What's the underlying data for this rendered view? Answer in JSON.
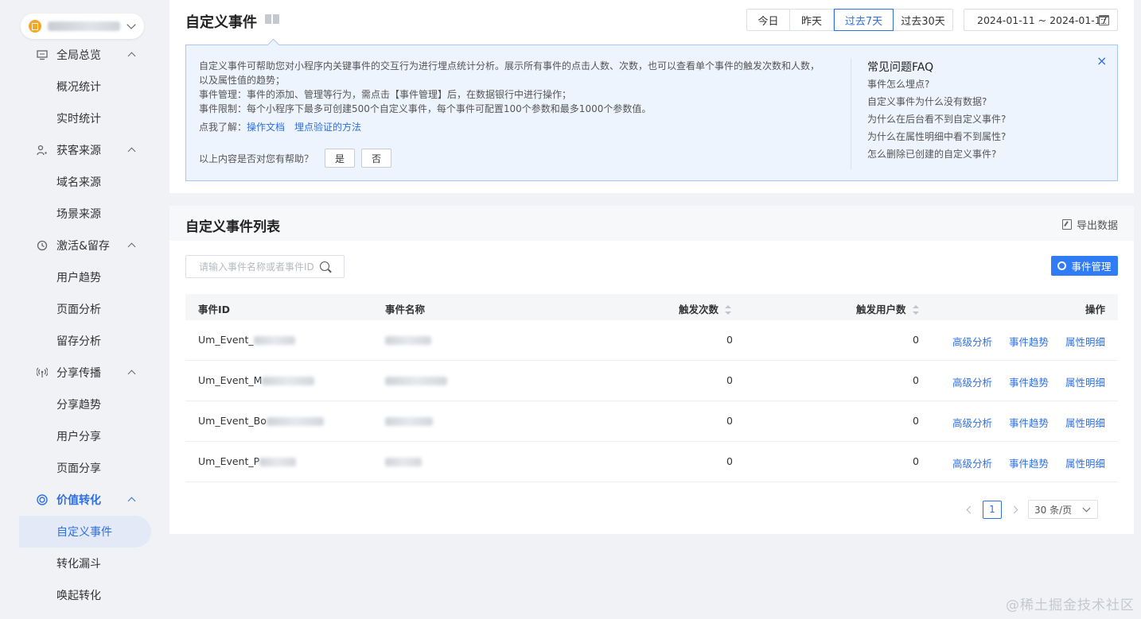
{
  "sidebar": {
    "groups": [
      {
        "label": "全局总览",
        "items": [
          "概况统计",
          "实时统计"
        ]
      },
      {
        "label": "获客来源",
        "items": [
          "域名来源",
          "场景来源"
        ]
      },
      {
        "label": "激活&留存",
        "items": [
          "用户趋势",
          "页面分析",
          "留存分析"
        ]
      },
      {
        "label": "分享传播",
        "items": [
          "分享趋势",
          "用户分享",
          "页面分享"
        ]
      },
      {
        "label": "价值转化",
        "items": [
          "自定义事件",
          "转化漏斗",
          "唤起转化"
        ]
      }
    ],
    "active_item": "自定义事件"
  },
  "header": {
    "title": "自定义事件",
    "ranges": [
      "今日",
      "昨天",
      "过去7天",
      "过去30天"
    ],
    "active_range": "过去7天",
    "date_range": "2024-01-11 ~ 2024-01-17"
  },
  "help": {
    "lines": [
      "自定义事件可帮助您对小程序内关键事件的交互行为进行埋点统计分析。展示所有事件的点击人数、次数，也可以查看单个事件的触发次数和人数，以及属性值的趋势；",
      "事件管理：事件的添加、管理等行为，需点击【事件管理】后，在数据银行中进行操作；",
      "事件限制：每个小程序下最多可创建500个自定义事件，每个事件可配置100个参数和最多1000个参数值。"
    ],
    "learn_prefix": "点我了解：",
    "links": [
      "操作文档",
      "埋点验证的方法"
    ],
    "feedback_question": "以上内容是否对您有帮助？",
    "yes": "是",
    "no": "否",
    "faq_title": "常见问题FAQ",
    "faq": [
      "事件怎么埋点?",
      "自定义事件为什么没有数据?",
      "为什么在后台看不到自定义事件?",
      "为什么在属性明细中看不到属性?",
      "怎么删除已创建的自定义事件?"
    ]
  },
  "list": {
    "title": "自定义事件列表",
    "export_label": "导出数据",
    "search_placeholder": "请输入事件名称或者事件ID",
    "manage_label": "事件管理",
    "columns": [
      "事件ID",
      "事件名称",
      "触发次数",
      "触发用户数",
      "操作"
    ],
    "rows": [
      {
        "id": "Um_Event_",
        "name": "",
        "count": "0",
        "users": "0"
      },
      {
        "id": "Um_Event_M",
        "name": "",
        "count": "0",
        "users": "0"
      },
      {
        "id": "Um_Event_Bo",
        "name": "",
        "count": "0",
        "users": "0"
      },
      {
        "id": "Um_Event_P",
        "name": "",
        "count": "0",
        "users": "0"
      }
    ],
    "ops": [
      "高级分析",
      "事件趋势",
      "属性明细"
    ],
    "page": "1",
    "page_size": "30 条/页"
  },
  "watermark": "@稀土掘金技术社区"
}
